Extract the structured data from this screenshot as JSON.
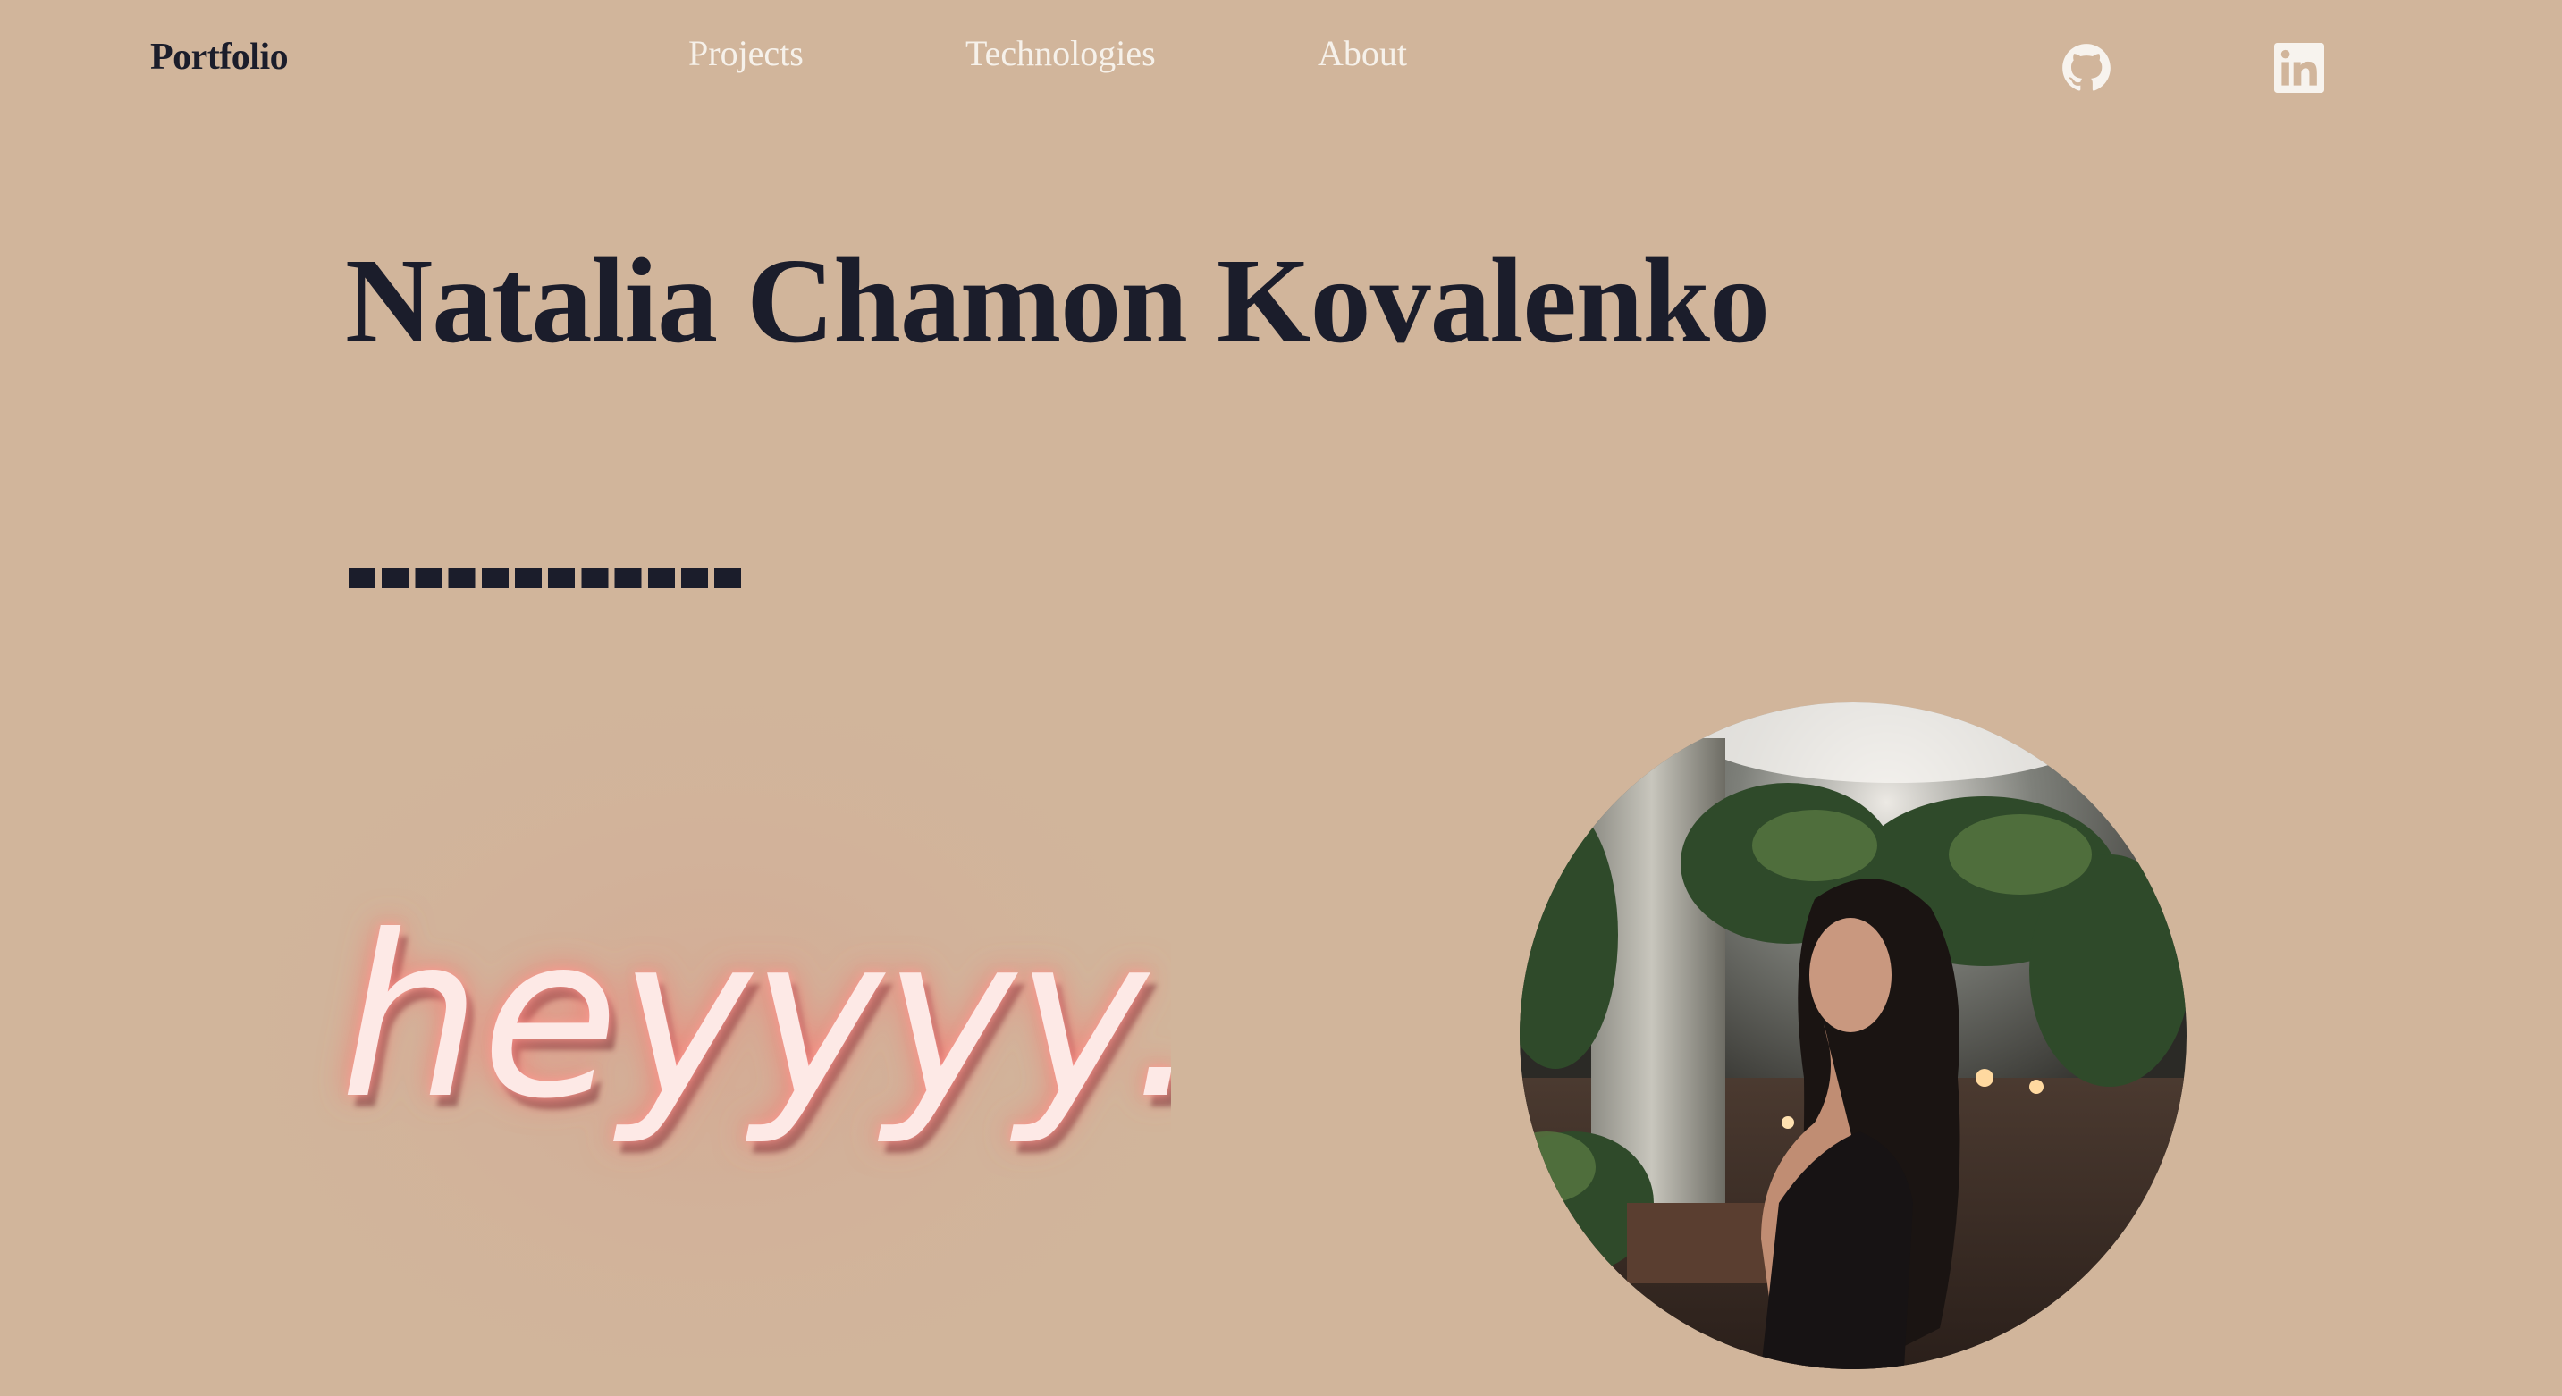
{
  "header": {
    "brand": "Portfolio",
    "nav": [
      {
        "label": "Projects"
      },
      {
        "label": "Technologies"
      },
      {
        "label": "About"
      }
    ],
    "social": [
      {
        "icon": "github-icon"
      },
      {
        "icon": "linkedin-icon"
      }
    ]
  },
  "hero": {
    "name": "Natalia Chamon Kovalenko",
    "divider": "------------",
    "neon_text": "heyyyy..",
    "photo_alt": "Profile photo"
  },
  "colors": {
    "background": "#d1b59b",
    "text_dark": "#1b1d2b",
    "nav_text": "#f6f1ea",
    "neon_pink": "#ff6f6b",
    "neon_letter": "#fde9e6"
  }
}
